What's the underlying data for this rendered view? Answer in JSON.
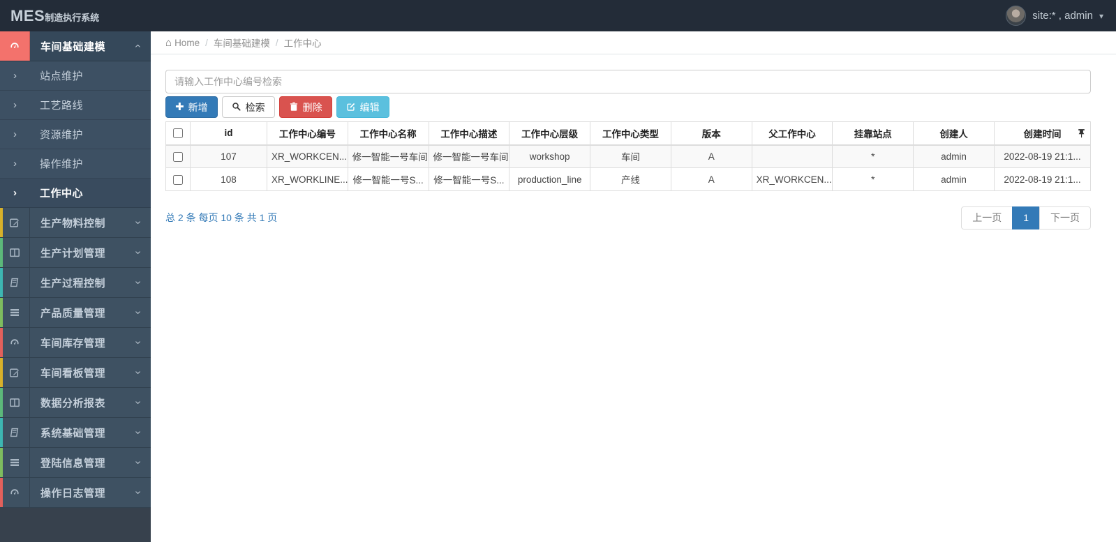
{
  "topbar": {
    "logo_primary": "MES",
    "logo_secondary": "制造执行系统",
    "user_label": "site:* , admin"
  },
  "glyphs": {
    "caret_down": "▾",
    "chevron": "›",
    "home": "⌂",
    "separator": "/",
    "plus": "✚"
  },
  "breadcrumb": {
    "home": "Home",
    "section": "车间基础建模",
    "page": "工作中心"
  },
  "sidebar": {
    "group": {
      "label": "车间基础建模",
      "icon": "dashboard-icon",
      "icon_bg": "#f3726c"
    },
    "submenu": [
      {
        "label": "站点维护",
        "active": false
      },
      {
        "label": "工艺路线",
        "active": false
      },
      {
        "label": "资源维护",
        "active": false
      },
      {
        "label": "操作维护",
        "active": false
      },
      {
        "label": "工作中心",
        "active": true
      }
    ],
    "items": [
      {
        "label": "生产物料控制",
        "icon": "pencil-icon",
        "strip": "#d8b12a"
      },
      {
        "label": "生产计划管理",
        "icon": "columns-icon",
        "strip": "#5cb87a"
      },
      {
        "label": "生产过程控制",
        "icon": "book-icon",
        "strip": "#3db6b2"
      },
      {
        "label": "产品质量管理",
        "icon": "list-icon",
        "strip": "#7ebd5f"
      },
      {
        "label": "车间库存管理",
        "icon": "dashboard-icon",
        "strip": "#e2605c"
      },
      {
        "label": "车间看板管理",
        "icon": "pencil-icon",
        "strip": "#d8b12a"
      },
      {
        "label": "数据分析报表",
        "icon": "columns-icon",
        "strip": "#5cb87a"
      },
      {
        "label": "系统基础管理",
        "icon": "book-icon",
        "strip": "#3db6b2"
      },
      {
        "label": "登陆信息管理",
        "icon": "list-icon",
        "strip": "#7ebd5f"
      },
      {
        "label": "操作日志管理",
        "icon": "dashboard-icon",
        "strip": "#e2605c"
      }
    ]
  },
  "search": {
    "placeholder": "请输入工作中心编号检索",
    "value": ""
  },
  "toolbar": {
    "add_label": "新增",
    "search_label": "检索",
    "delete_label": "删除",
    "edit_label": "编辑"
  },
  "table": {
    "columns": [
      "id",
      "工作中心编号",
      "工作中心名称",
      "工作中心描述",
      "工作中心层级",
      "工作中心类型",
      "版本",
      "父工作中心",
      "挂靠站点",
      "创建人",
      "创建时间"
    ],
    "rows": [
      [
        "107",
        "XR_WORKCEN...",
        "修一智能一号车间",
        "修一智能一号车间",
        "workshop",
        "车间",
        "A",
        "",
        "*",
        "admin",
        "2022-08-19 21:1..."
      ],
      [
        "108",
        "XR_WORKLINE...",
        "修一智能一号S...",
        "修一智能一号S...",
        "production_line",
        "产线",
        "A",
        "XR_WORKCEN...",
        "*",
        "admin",
        "2022-08-19 21:1..."
      ]
    ]
  },
  "pagination": {
    "summary": "总 2 条 每页 10 条 共 1 页",
    "prev_label": "上一页",
    "page_label": "1",
    "next_label": "下一页"
  },
  "colors": {
    "topbar_bg": "#232c38",
    "sidebar_item_bg": "#3e5162",
    "sidebar_active_bg": "#35485a",
    "active_icon_bg": "#f3726c",
    "primary": "#337ab7",
    "danger": "#d9534f",
    "info": "#5bc0de",
    "row_stripe": "#f9f9f9"
  }
}
